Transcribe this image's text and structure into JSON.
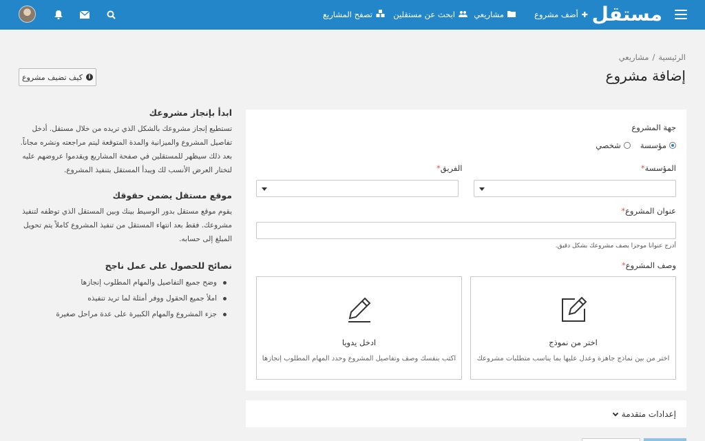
{
  "header": {
    "logo": "مستقل",
    "nav": {
      "add_project": "أضف مشروع",
      "my_projects": "مشاريعي",
      "find_freelancers": "ابحث عن مستقلين",
      "browse_projects": "تصفح المشاريع"
    },
    "icons": [
      "menu-icon",
      "plus-icon",
      "folder-icon",
      "users-icon",
      "cubes-icon",
      "search-icon",
      "envelope-icon",
      "bell-icon"
    ]
  },
  "breadcrumb": {
    "home": "الرئيسية",
    "separator": "/",
    "current": "مشاريعي"
  },
  "page": {
    "title": "إضافة مشروع",
    "how_button": "كيف تضيف مشروع"
  },
  "sidebar": {
    "section1": {
      "title": "ابدأ بإنجاز مشروعك",
      "body": "تستطيع إنجاز مشروعك بالشكل الذي تريده من خلال مستقل. أدخل تفاصيل المشروع والميزانية والمدة المتوقعة ليتم مراجعته ونشره مجاناً. بعد ذلك سيظهر للمستقلين في صفحة المشاريع ويقدموا عروضهم عليه لتختار العرض الأنسب لك ويبدأ المستقل بتنفيذ المشروع."
    },
    "section2": {
      "title": "موقع مستقل يضمن حقوقك",
      "body": "يقوم موقع مستقل بدور الوسيط بينك وبين المستقل الذي توظفه لتنفيذ مشروعك. فقط بعد انتهاء المستقل من تنفيذ المشروع كاملاً يتم تحويل المبلغ إلى حسابه."
    },
    "section3": {
      "title": "نصائح للحصول على عمل ناجح",
      "tips": [
        "وضح جميع التفاصيل والمهام المطلوب إنجازها",
        "املأ جميع الحقول ووفر أمثلة لما تريد تنفيذه",
        "جزء المشروع والمهام الكبيرة على عدة مراحل صغيرة"
      ]
    }
  },
  "form": {
    "entity_label": "جهة المشروع",
    "entity_options": {
      "personal": "شخصي",
      "institution": "مؤسسة"
    },
    "entity_selected": "institution",
    "institution_label": "المؤسسة",
    "team_label": "الفريق",
    "required_mark": "*",
    "title_label": "عنوان المشروع",
    "title_value": "",
    "title_hint": "أدرج عنوانا موجزا يصف مشروعك بشكل دقيق.",
    "description_label": "وصف المشروع",
    "template_card": {
      "title": "اختر من نموذج",
      "description": "اختر من بين نماذج جاهزة وعدل عليها بما يناسب متطلبات مشروعك"
    },
    "manual_card": {
      "title": "ادخل يدويا",
      "description": "اكتب بنفسك وصف وتفاصيل المشروع وحدد المهام المطلوب إنجازها"
    }
  },
  "advanced": {
    "label": "إعدادات متقدمة"
  },
  "colors": {
    "primary": "#2386c8",
    "background": "#f2f2f2",
    "required": "#d9534f"
  }
}
